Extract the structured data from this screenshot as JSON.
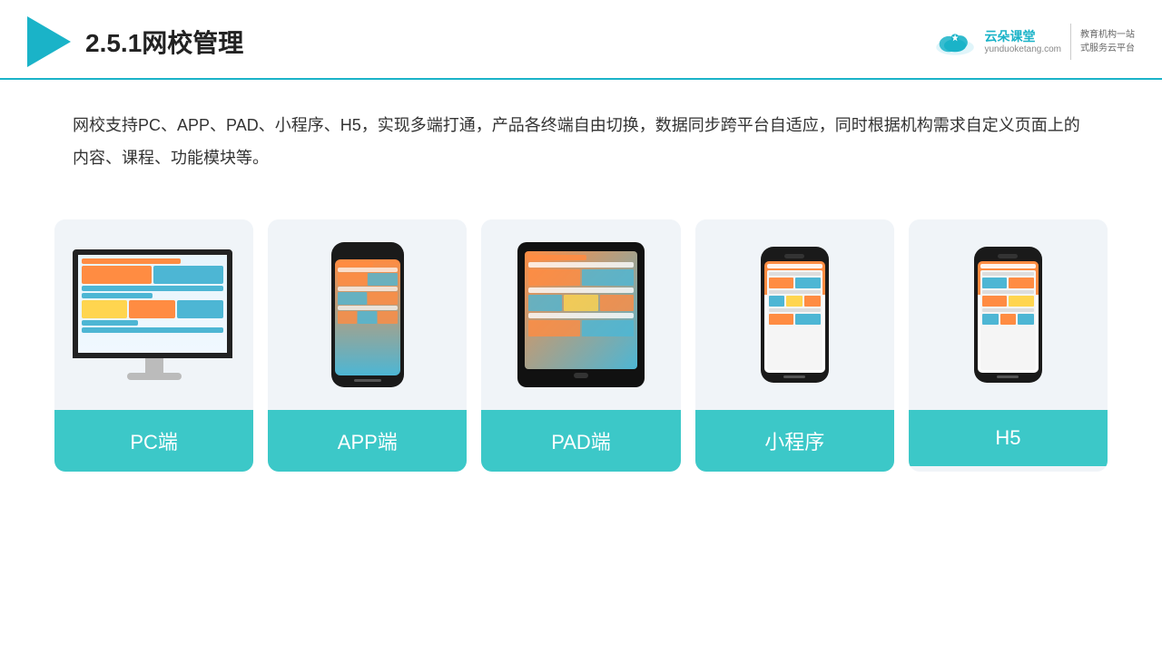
{
  "header": {
    "title_number": "2.5.1",
    "title_text": "网校管理",
    "logo_name": "云朵课堂",
    "logo_url": "yunduoketang.com",
    "logo_tagline_line1": "教育机构一站",
    "logo_tagline_line2": "式服务云平台"
  },
  "description": {
    "text": "网校支持PC、APP、PAD、小程序、H5，实现多端打通，产品各终端自由切换，数据同步跨平台自适应，同时根据机构需求自定义页面上的内容、课程、功能模块等。"
  },
  "cards": [
    {
      "id": "pc",
      "label": "PC端"
    },
    {
      "id": "app",
      "label": "APP端"
    },
    {
      "id": "pad",
      "label": "PAD端"
    },
    {
      "id": "miniprogram",
      "label": "小程序"
    },
    {
      "id": "h5",
      "label": "H5"
    }
  ]
}
